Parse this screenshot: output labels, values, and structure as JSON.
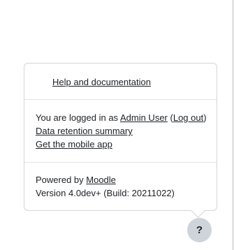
{
  "footer_popover": {
    "help_link": "Help and documentation",
    "login": {
      "prefix": "You are logged in as ",
      "user_name": "Admin User",
      "paren_open": " (",
      "logout_label": "Log out",
      "paren_close": ")"
    },
    "data_retention_link": "Data retention summary",
    "mobile_app_link": "Get the mobile app",
    "powered_by": {
      "prefix": "Powered by ",
      "brand": "Moodle"
    },
    "version": "Version 4.0dev+ (Build: 20211022)"
  },
  "help_button": {
    "glyph": "?",
    "icon": "question-mark-icon"
  }
}
